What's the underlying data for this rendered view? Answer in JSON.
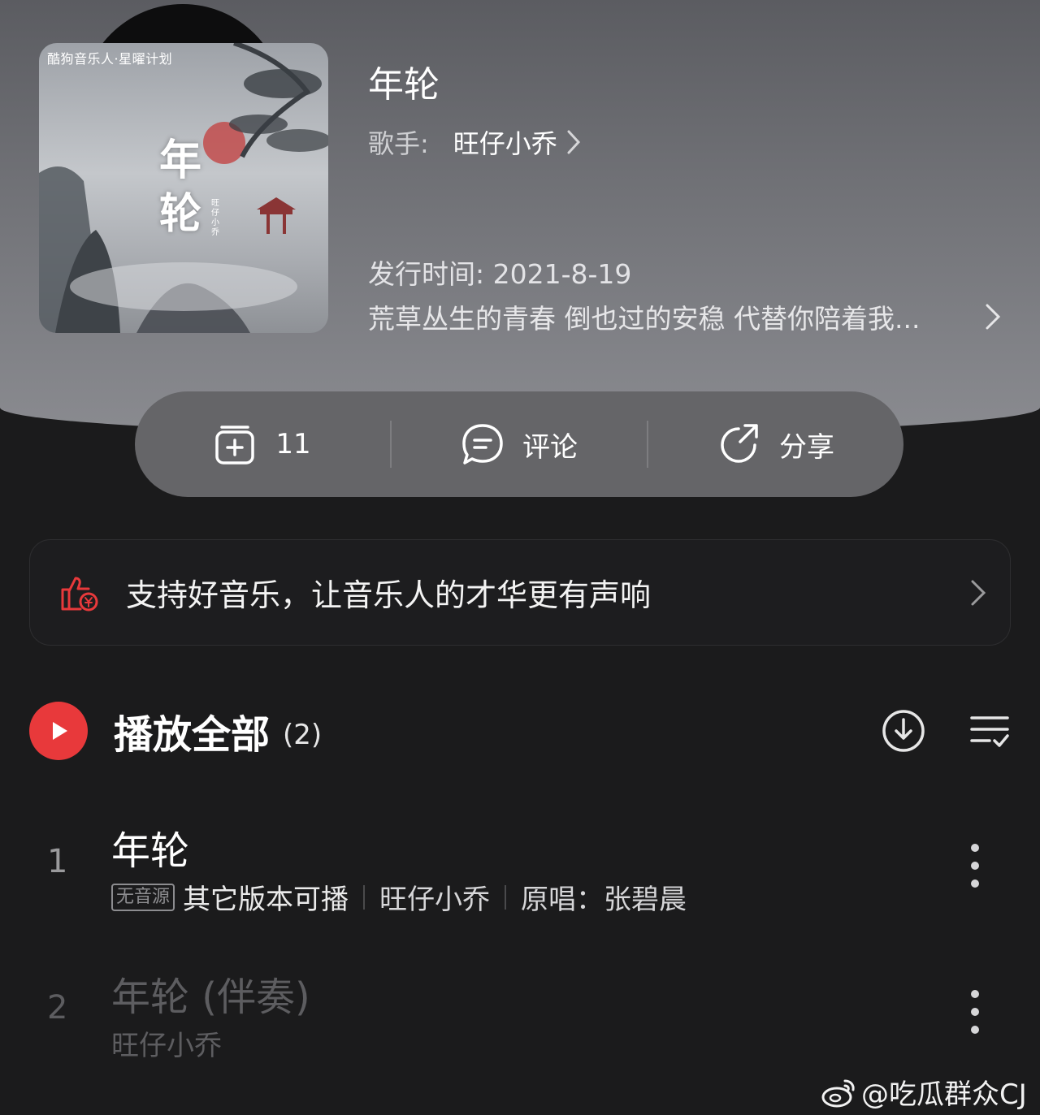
{
  "album": {
    "cover_tag": "酷狗音乐人·星曜计划",
    "cover_title_chars": [
      "年",
      "轮"
    ],
    "cover_artist": "旺仔小乔"
  },
  "song": {
    "title": "年轮",
    "singer_label": "歌手:",
    "singer_name": "旺仔小乔",
    "release": "发行时间: 2021-8-19",
    "description": "荒草丛生的青春 倒也过的安稳 代替你陪着我..."
  },
  "actions": {
    "collect_count": "11",
    "comment_label": "评论",
    "share_label": "分享"
  },
  "banner": {
    "text": "支持好音乐，让音乐人的才华更有声响"
  },
  "play_all": {
    "label": "播放全部",
    "count": "(2)"
  },
  "tracks": [
    {
      "num": "1",
      "title": "年轮",
      "badge": "无音源",
      "note": "其它版本可播",
      "artist": "旺仔小乔",
      "original": "原唱：张碧晨"
    },
    {
      "num": "2",
      "title": "年轮 (伴奏)",
      "artist": "旺仔小乔"
    }
  ],
  "watermark": "@吃瓜群众CJ",
  "colors": {
    "accent_red": "#e8393b",
    "background": "#1b1b1c",
    "action_bar": "#656568"
  }
}
